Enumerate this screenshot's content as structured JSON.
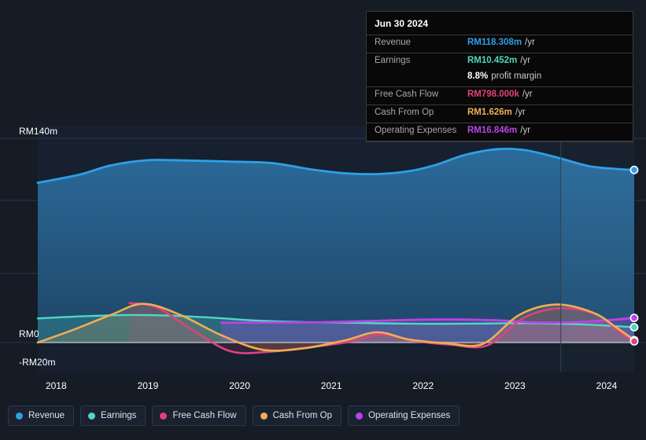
{
  "colors": {
    "background": "#151c26",
    "plot_background": "#16202e",
    "plot_background_forecast": "#1b2a3c",
    "revenue": "#2f9fe8",
    "earnings": "#4fd8c0",
    "free_cash_flow": "#e0417f",
    "cash_from_op": "#efae54",
    "operating_expenses": "#b844e8",
    "gridline": "#2a3342",
    "zero_line": "#b8bcc2",
    "axis_text": "#ffffff",
    "tooltip_bg": "#080808",
    "tooltip_border": "#3a3a3a",
    "tooltip_key": "#a8a8a8"
  },
  "tooltip": {
    "title": "Jun 30 2024",
    "rows": [
      {
        "key": "Revenue",
        "value": "RM118.308m",
        "unit": "/yr",
        "color": "#2f9fe8"
      },
      {
        "key": "Earnings",
        "value": "RM10.452m",
        "unit": "/yr",
        "color": "#4fd8c0"
      },
      {
        "key": "Free Cash Flow",
        "value": "RM798.000k",
        "unit": "/yr",
        "color": "#e0417f"
      },
      {
        "key": "Cash From Op",
        "value": "RM1.626m",
        "unit": "/yr",
        "color": "#efae54"
      },
      {
        "key": "Operating Expenses",
        "value": "RM16.846m",
        "unit": "/yr",
        "color": "#b844e8"
      }
    ],
    "margin_value": "8.8%",
    "margin_label": "profit margin"
  },
  "legend": {
    "items": [
      {
        "label": "Revenue",
        "color": "#2f9fe8"
      },
      {
        "label": "Earnings",
        "color": "#4fd8c0"
      },
      {
        "label": "Free Cash Flow",
        "color": "#e0417f"
      },
      {
        "label": "Cash From Op",
        "color": "#efae54"
      },
      {
        "label": "Operating Expenses",
        "color": "#b844e8"
      }
    ]
  },
  "chart_data": {
    "type": "area",
    "title": "",
    "xlabel": "",
    "ylabel": "",
    "currency": "RM",
    "grid": true,
    "legend_position": "bottom",
    "y_ticks": [
      {
        "label": "RM140m",
        "value": 140
      },
      {
        "label": "RM0",
        "value": 0
      },
      {
        "label": "-RM20m",
        "value": -20
      }
    ],
    "ylim": [
      -20,
      140
    ],
    "x_ticks": [
      "2018",
      "2019",
      "2020",
      "2021",
      "2022",
      "2023",
      "2024"
    ],
    "xlim": [
      2017.8,
      2024.3
    ],
    "forecast_start_x": 2023.5,
    "series": [
      {
        "name": "Revenue",
        "color": "#2f9fe8",
        "x": [
          2017.8,
          2018.25,
          2018.6,
          2019.0,
          2019.4,
          2019.9,
          2020.35,
          2020.8,
          2021.15,
          2021.5,
          2021.85,
          2022.15,
          2022.45,
          2022.8,
          2023.1,
          2023.45,
          2023.8,
          2024.1,
          2024.3
        ],
        "values": [
          109.5,
          115.0,
          121.5,
          125.0,
          124.8,
          124.0,
          123.0,
          118.5,
          116.0,
          115.5,
          117.5,
          122.0,
          128.5,
          132.5,
          132.0,
          127.0,
          121.0,
          119.0,
          118.308
        ]
      },
      {
        "name": "Earnings",
        "color": "#4fd8c0",
        "x": [
          2017.8,
          2018.3,
          2018.8,
          2019.2,
          2019.7,
          2020.2,
          2020.7,
          2021.2,
          2021.7,
          2022.2,
          2022.7,
          2023.2,
          2023.7,
          2024.1,
          2024.3
        ],
        "values": [
          16.5,
          18.0,
          18.8,
          18.5,
          17.0,
          15.0,
          14.0,
          13.5,
          13.0,
          12.8,
          13.0,
          13.2,
          12.5,
          11.2,
          10.452
        ]
      },
      {
        "name": "Free Cash Flow",
        "color": "#e0417f",
        "x": [
          2018.8,
          2019.1,
          2019.5,
          2019.9,
          2020.3,
          2020.8,
          2021.2,
          2021.55,
          2021.9,
          2022.3,
          2022.7,
          2023.1,
          2023.5,
          2023.9,
          2024.1,
          2024.3
        ],
        "values": [
          27.0,
          24.0,
          8.0,
          -6.0,
          -6.5,
          -3.0,
          0.5,
          5.5,
          1.0,
          -1.5,
          -2.0,
          17.0,
          23.5,
          19.0,
          9.0,
          0.798
        ]
      },
      {
        "name": "Cash From Op",
        "color": "#efae54",
        "x": [
          2017.8,
          2018.2,
          2018.6,
          2018.95,
          2019.35,
          2019.8,
          2020.25,
          2020.7,
          2021.15,
          2021.5,
          2021.85,
          2022.25,
          2022.65,
          2023.05,
          2023.45,
          2023.85,
          2024.1,
          2024.3
        ],
        "values": [
          0.0,
          9.0,
          19.0,
          26.5,
          19.0,
          5.0,
          -5.0,
          -4.0,
          1.5,
          7.0,
          2.0,
          -0.5,
          -1.0,
          19.0,
          26.0,
          20.5,
          10.5,
          1.626
        ]
      },
      {
        "name": "Operating Expenses",
        "color": "#b844e8",
        "x": [
          2019.8,
          2020.3,
          2020.8,
          2021.3,
          2021.8,
          2022.3,
          2022.8,
          2023.2,
          2023.6,
          2024.0,
          2024.3
        ],
        "values": [
          13.5,
          13.6,
          13.8,
          14.5,
          15.4,
          15.8,
          15.2,
          13.8,
          13.8,
          15.2,
          16.846
        ]
      }
    ]
  }
}
